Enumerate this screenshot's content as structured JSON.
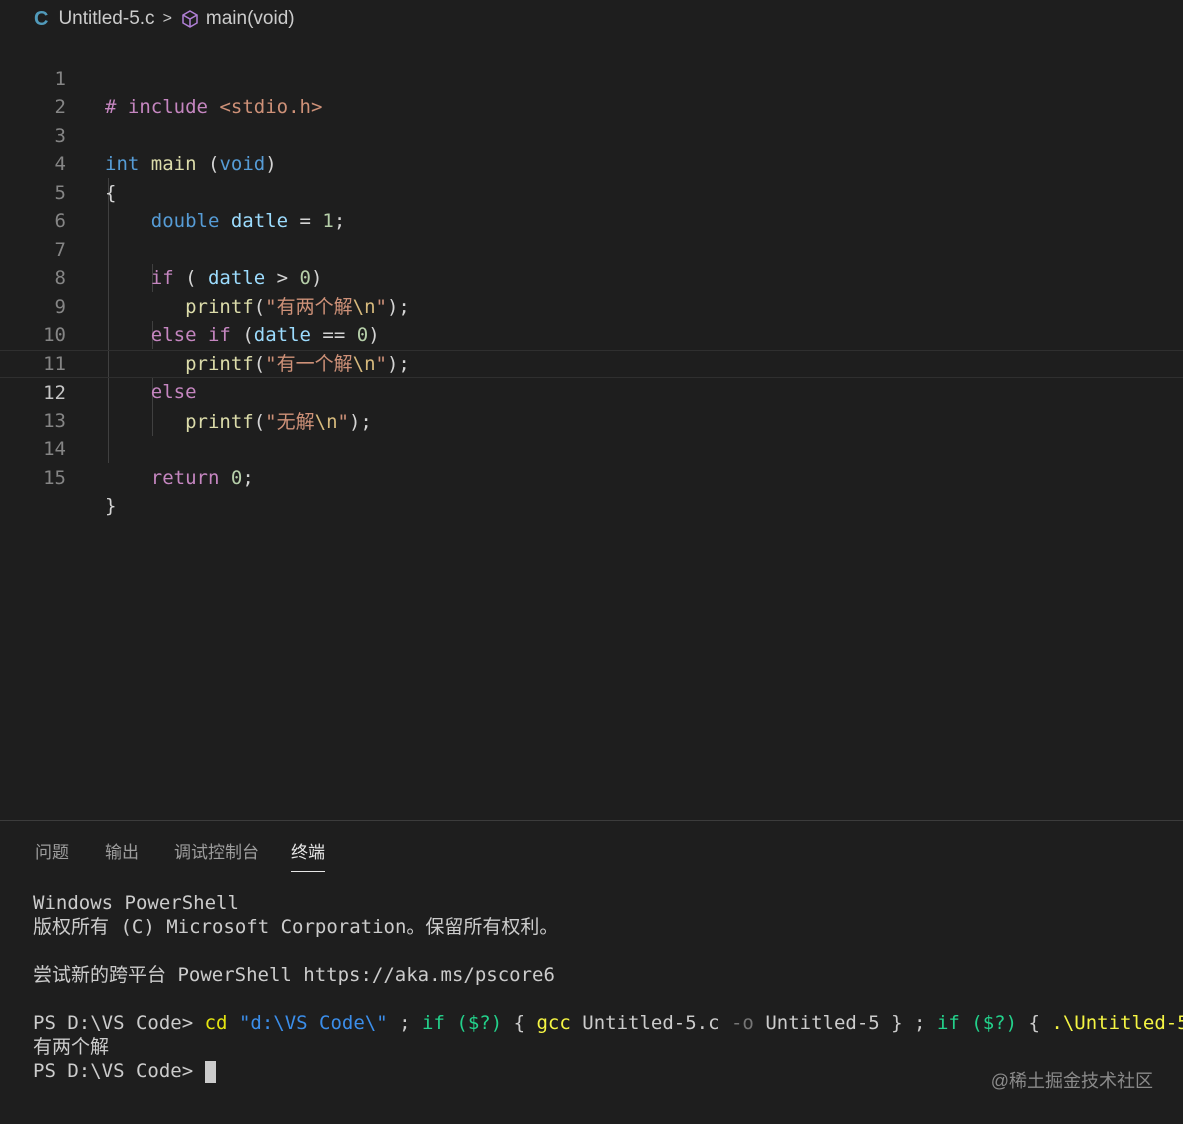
{
  "breadcrumb": {
    "lang_icon": "C",
    "file": "Untitled-5.c",
    "separator": ">",
    "symbol": "main(void)"
  },
  "editor": {
    "active_line": 12,
    "line_numbers": [
      "1",
      "2",
      "3",
      "4",
      "5",
      "6",
      "7",
      "8",
      "9",
      "10",
      "11",
      "12",
      "13",
      "14",
      "15"
    ],
    "lines": {
      "l1_hash": "#",
      "l1_include": "include",
      "l1_header": "<stdio.h>",
      "l3_int": "int",
      "l3_main": "main",
      "l3_void": "void",
      "l5_double": "double",
      "l5_var": "datle",
      "l5_val": "1",
      "l7_if": "if",
      "l7_var": "datle",
      "l7_val": "0",
      "l8_fn": "printf",
      "l8_str": "有两个解",
      "l8_esc": "\\n",
      "l9_else": "else",
      "l9_if": "if",
      "l9_var": "datle",
      "l9_val": "0",
      "l10_fn": "printf",
      "l10_str": "有一个解",
      "l10_esc": "\\n",
      "l11_else": "else",
      "l12_fn": "printf",
      "l12_str": "无解",
      "l12_esc": "\\n",
      "l14_return": "return",
      "l14_val": "0"
    }
  },
  "panel": {
    "tabs": [
      {
        "label": "问题"
      },
      {
        "label": "输出"
      },
      {
        "label": "调试控制台"
      },
      {
        "label": "终端"
      }
    ],
    "active_tab": "终端",
    "terminal": {
      "line1": "Windows PowerShell",
      "line2": "版权所有 (C) Microsoft Corporation。保留所有权利。",
      "line3": "尝试新的跨平台 PowerShell https://aka.ms/pscore6",
      "prompt": "PS D:\\VS Code>",
      "cmd_cd": "cd",
      "cmd_path": "\"d:\\VS Code\\\"",
      "cmd_semi1": ";",
      "cmd_if1": "if",
      "cmd_cond1": "($?)",
      "cmd_gcc": "gcc",
      "cmd_src": "Untitled-5.c",
      "cmd_o": "-o",
      "cmd_out": "Untitled-5",
      "cmd_semi2": ";",
      "cmd_if2": "if",
      "cmd_cond2": "($?)",
      "cmd_run": ".\\Untitled-5",
      "output": "有两个解",
      "prompt2": "PS D:\\VS Code>"
    }
  },
  "watermark": "@稀土掘金技术社区"
}
